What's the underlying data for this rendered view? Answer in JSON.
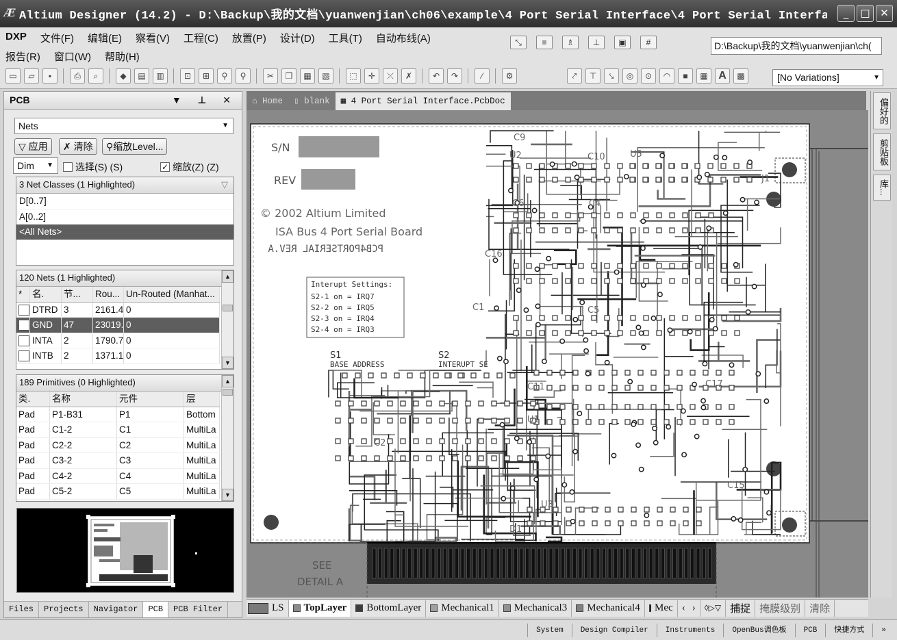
{
  "window": {
    "title": "Altium Designer (14.2) - D:\\Backup\\我的文档\\yuanwenjian\\ch06\\example\\4 Port Serial Interface\\4 Port Serial Interface...",
    "icon_label": "Æ",
    "buttons": [
      "_",
      "□",
      "✕"
    ]
  },
  "menu": {
    "row1": [
      "DXP",
      "文件(F)",
      "编辑(E)",
      "察看(V)",
      "工程(C)",
      "放置(P)",
      "设计(D)",
      "工具(T)",
      "自动布线(A)"
    ],
    "row2": [
      "报告(R)",
      "窗口(W)",
      "帮助(H)"
    ]
  },
  "toolbar": {
    "path": "D:\\Backup\\我的文档\\yuanwenjian\\ch(",
    "variations": "[No Variations]"
  },
  "panel": {
    "title": "PCB",
    "controls": "▼ ⊥ ✕",
    "mode_combo": "Nets",
    "apply_btn": "应用",
    "clear_btn": "清除",
    "zoom_btn": "缩放Level...",
    "dim_combo": "Dim",
    "select_chk": "选择(S) (S)",
    "zoom_chk": "缩放(Z) (Z)",
    "classes_header": "3 Net Classes (1 Highlighted)",
    "classes": [
      "D[0..7]",
      "A[0..2]",
      "<All Nets>"
    ],
    "nets_header": "120 Nets (1 Highlighted)",
    "nets_cols": [
      "*",
      "名.",
      "节...",
      "Rou...",
      "Un-Routed (Manhat..."
    ],
    "nets": [
      {
        "name": "DTRD",
        "nodes": "3",
        "routed": "2161.4",
        "unrouted": "0"
      },
      {
        "name": "GND",
        "nodes": "47",
        "routed": "23019.",
        "unrouted": "0"
      },
      {
        "name": "INTA",
        "nodes": "2",
        "routed": "1790.7",
        "unrouted": "0"
      },
      {
        "name": "INTB",
        "nodes": "2",
        "routed": "1371.1",
        "unrouted": "0"
      }
    ],
    "prims_header": "189 Primitives (0 Highlighted)",
    "prims_cols": [
      "类.",
      "名称",
      "元件",
      "层"
    ],
    "prims": [
      {
        "type": "Pad",
        "name": "P1-B31",
        "comp": "P1",
        "layer": "Bottom"
      },
      {
        "type": "Pad",
        "name": "C1-2",
        "comp": "C1",
        "layer": "MultiLa"
      },
      {
        "type": "Pad",
        "name": "C2-2",
        "comp": "C2",
        "layer": "MultiLa"
      },
      {
        "type": "Pad",
        "name": "C3-2",
        "comp": "C3",
        "layer": "MultiLa"
      },
      {
        "type": "Pad",
        "name": "C4-2",
        "comp": "C4",
        "layer": "MultiLa"
      },
      {
        "type": "Pad",
        "name": "C5-2",
        "comp": "C5",
        "layer": "MultiLa"
      }
    ],
    "tabs": [
      "Files",
      "Projects",
      "Navigator",
      "PCB",
      "PCB Filter"
    ]
  },
  "doc_tabs": [
    "Home",
    "blank",
    "4 Port Serial Interface.PcbDoc"
  ],
  "board": {
    "sn": "S/N",
    "rev": "REV",
    "copyright": "© 2002 Altium Limited",
    "board_name": "ISA Bus 4 Port Serial Board",
    "mirrored": "PCB4PORTSERIAL REV.A",
    "irq_title": "Interupt Settings:",
    "irq_lines": [
      "S2-1 on = IRQ7",
      "S2-2 on = IRQ5",
      "S2-3 on = IRQ4",
      "S2-4 on = IRQ3"
    ],
    "s1": "S1",
    "s1_label": "BASE ADDRESS",
    "s2": "S2",
    "s2_label": "INTERUPT SE",
    "see_detail": [
      "SEE",
      "DETAIL A"
    ],
    "refdes": [
      "C9",
      "U2",
      "C10",
      "U5",
      "J1",
      "C6",
      "C4",
      "C16",
      "C1",
      "C5",
      "C15",
      "C17",
      "D1",
      "C11",
      "U1",
      "U3",
      "C2"
    ]
  },
  "right_tabs": [
    "偏好的",
    "剪贴板",
    "库..."
  ],
  "layers": [
    {
      "name": "LS",
      "color": "#7a7a7a"
    },
    {
      "name": "TopLayer",
      "color": "#8c8c8c"
    },
    {
      "name": "BottomLayer",
      "color": "#3c3c3c"
    },
    {
      "name": "Mechanical1",
      "color": "#a0a0a0"
    },
    {
      "name": "Mechanical3",
      "color": "#909090"
    },
    {
      "name": "Mechanical4",
      "color": "#808080"
    },
    {
      "name": "Mec",
      "color": "#000000"
    }
  ],
  "layer_actions": [
    "捕捉",
    "掩膜级别",
    "清除"
  ],
  "status": [
    "System",
    "Design Compiler",
    "Instruments",
    "OpenBus调色板",
    "PCB",
    "快捷方式"
  ]
}
